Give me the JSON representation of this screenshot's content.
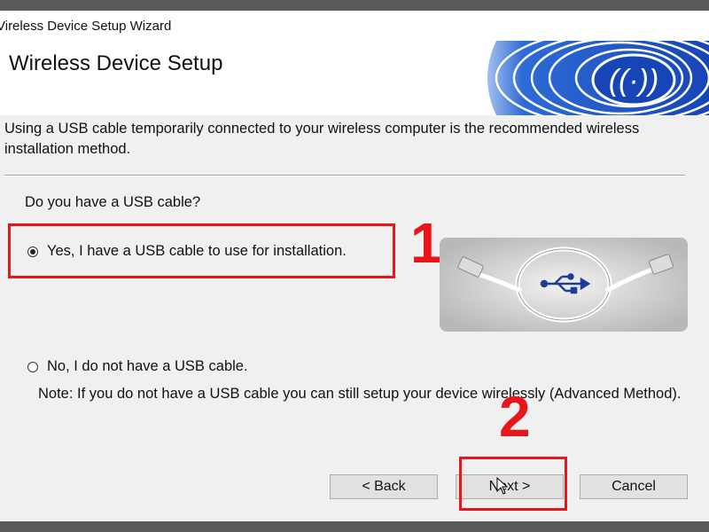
{
  "window": {
    "title": "Vireless Device Setup Wizard"
  },
  "header": {
    "title": "Wireless Device Setup"
  },
  "intro_text": "Using a USB cable temporarily connected to your wireless computer is the recommended wireless installation method.",
  "question": "Do you have a USB cable?",
  "options": [
    {
      "label": "Yes, I have a USB cable to use for installation.",
      "selected": true
    },
    {
      "label": "No, I do not have a USB cable.",
      "selected": false
    }
  ],
  "note": "Note: If you do not have a USB cable you can still setup your device wirelessly (Advanced Method).",
  "annotations": {
    "step1": "1",
    "step2": "2",
    "color": "#e8151b"
  },
  "buttons": {
    "back": "< Back",
    "next": "Next >",
    "cancel": "Cancel"
  },
  "icons": {
    "banner": "wireless-signal-icon",
    "usb": "usb-icon"
  }
}
